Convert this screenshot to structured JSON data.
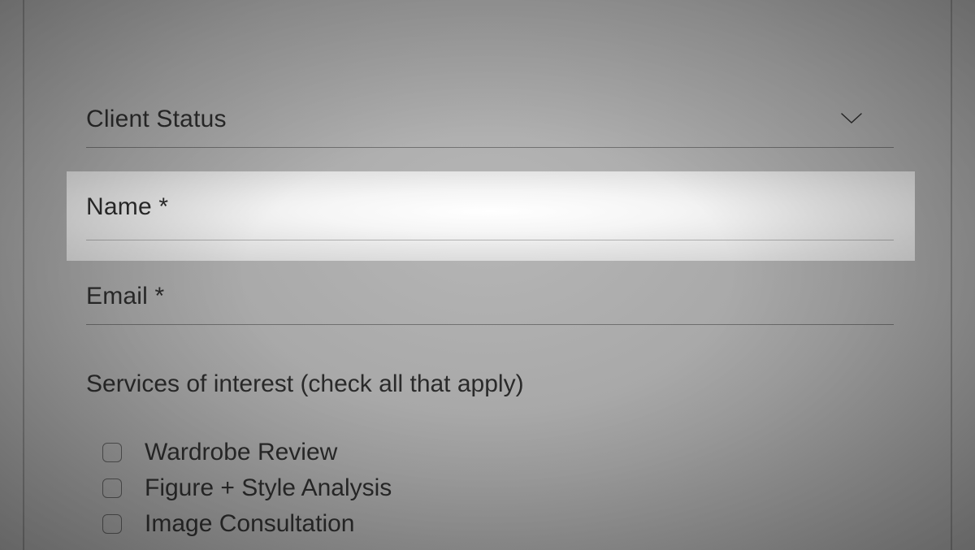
{
  "form": {
    "client_status": {
      "label": "Client Status"
    },
    "name": {
      "label": "Name *"
    },
    "email": {
      "label": "Email *"
    },
    "services": {
      "label": "Services of interest (check all that apply)",
      "options": [
        {
          "label": "Wardrobe Review"
        },
        {
          "label": "Figure + Style Analysis"
        },
        {
          "label": "Image Consultation"
        }
      ]
    }
  }
}
